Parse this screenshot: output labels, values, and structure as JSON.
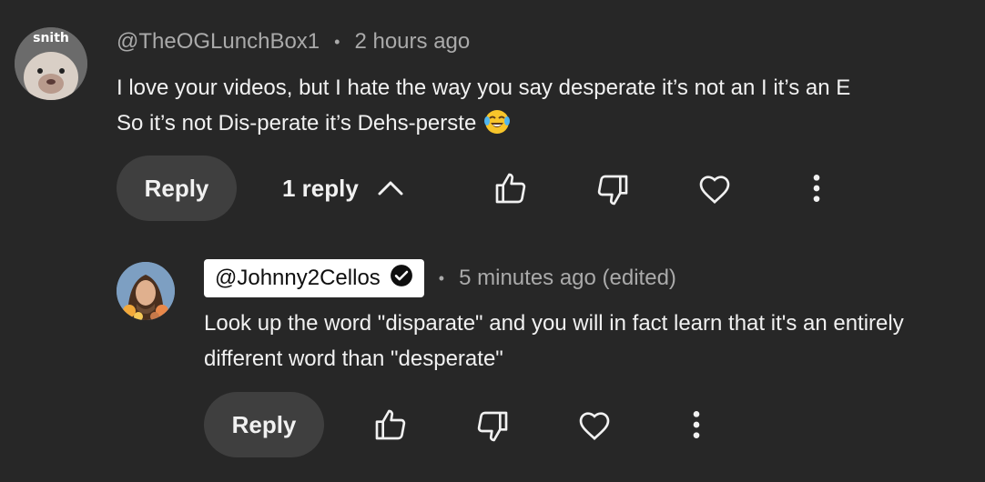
{
  "comment": {
    "avatar_text": "snith",
    "author": "@TheOGLunchBox1",
    "separator": "•",
    "time": "2 hours ago",
    "line1": "I love your videos, but I hate the way you say desperate it’s not an I it’s an E",
    "line2": "So it’s not Dis-perate it’s Dehs-perste",
    "emoji_icon": "laughing-tears-emoji",
    "reply_label": "Reply",
    "replies_toggle": "1 reply"
  },
  "reply": {
    "author": "@Johnny2Cellos",
    "separator": "•",
    "time": "5 minutes ago (edited)",
    "line1": "Look up the word \"disparate\" and you will in fact learn that it's an entirely",
    "line2": "different word than \"desperate\"",
    "reply_label": "Reply"
  },
  "icons": [
    "thumbs-up-icon",
    "thumbs-down-icon",
    "heart-icon",
    "more-vert-icon",
    "chevron-up-icon",
    "verified-check-icon"
  ],
  "colors": {
    "background": "#272727",
    "button": "#3f3f3f",
    "primary_text": "#f1f1f1",
    "secondary_text": "#aaaaaa",
    "owner_chip": "#ffffff"
  }
}
